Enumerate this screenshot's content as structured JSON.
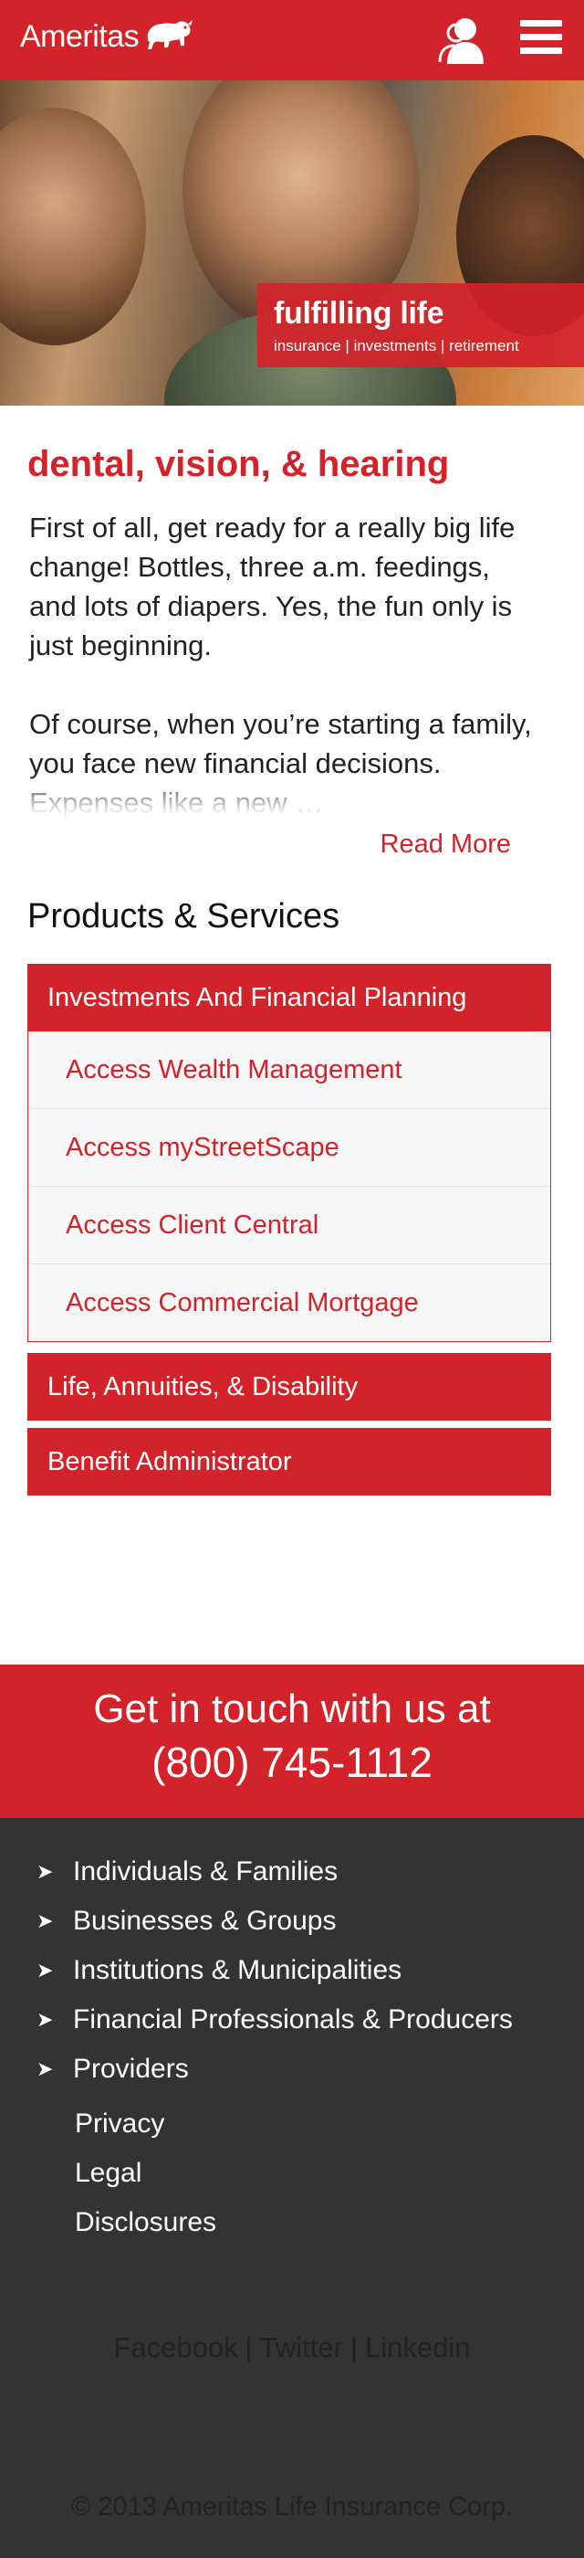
{
  "header": {
    "logo_text": "Ameritas",
    "logo_icon": "bison-icon",
    "user_icon": "user-icon",
    "menu_icon": "hamburger-menu-icon",
    "brand_color": "#d2232a"
  },
  "hero": {
    "title": "fulfilling life",
    "subtitle": "insurance | investments | retirement"
  },
  "article": {
    "headline": "dental, vision, & hearing",
    "paragraphs": [
      "First of all, get ready for a really big life change! Bottles, three a.m. feedings, and lots of diapers. Yes, the fun only is just beginning.",
      "Of course, when you’re starting a family, you face new financial decisions. Expenses like a new …"
    ],
    "read_more": "Read More"
  },
  "products": {
    "title": "Products & Services",
    "groups": [
      {
        "label": "Investments And Financial Planning",
        "items": [
          "Access Wealth Management",
          "Access myStreetScape",
          "Access Client Central",
          "Access Commercial Mortgage"
        ]
      },
      {
        "label": "Life, Annuities, & Disability"
      },
      {
        "label": "Benefit Administrator"
      }
    ]
  },
  "contact": {
    "line1": "Get in touch with us at",
    "phone": "(800) 745-1112"
  },
  "footer": {
    "nav_icon": "arrow-right-icon",
    "nav_items": [
      "Individuals & Families",
      "Businesses & Groups",
      "Institutions & Municipalities",
      "Financial Professionals & Producers",
      "Providers"
    ],
    "links": [
      "Privacy",
      "Legal",
      "Disclosures"
    ],
    "social": [
      "Facebook",
      "Twitter",
      "Linkedin"
    ],
    "social_separator": "|",
    "copyright": "© 2013 Ameritas Life Insurance Corp.",
    "background_color": "#333333"
  }
}
